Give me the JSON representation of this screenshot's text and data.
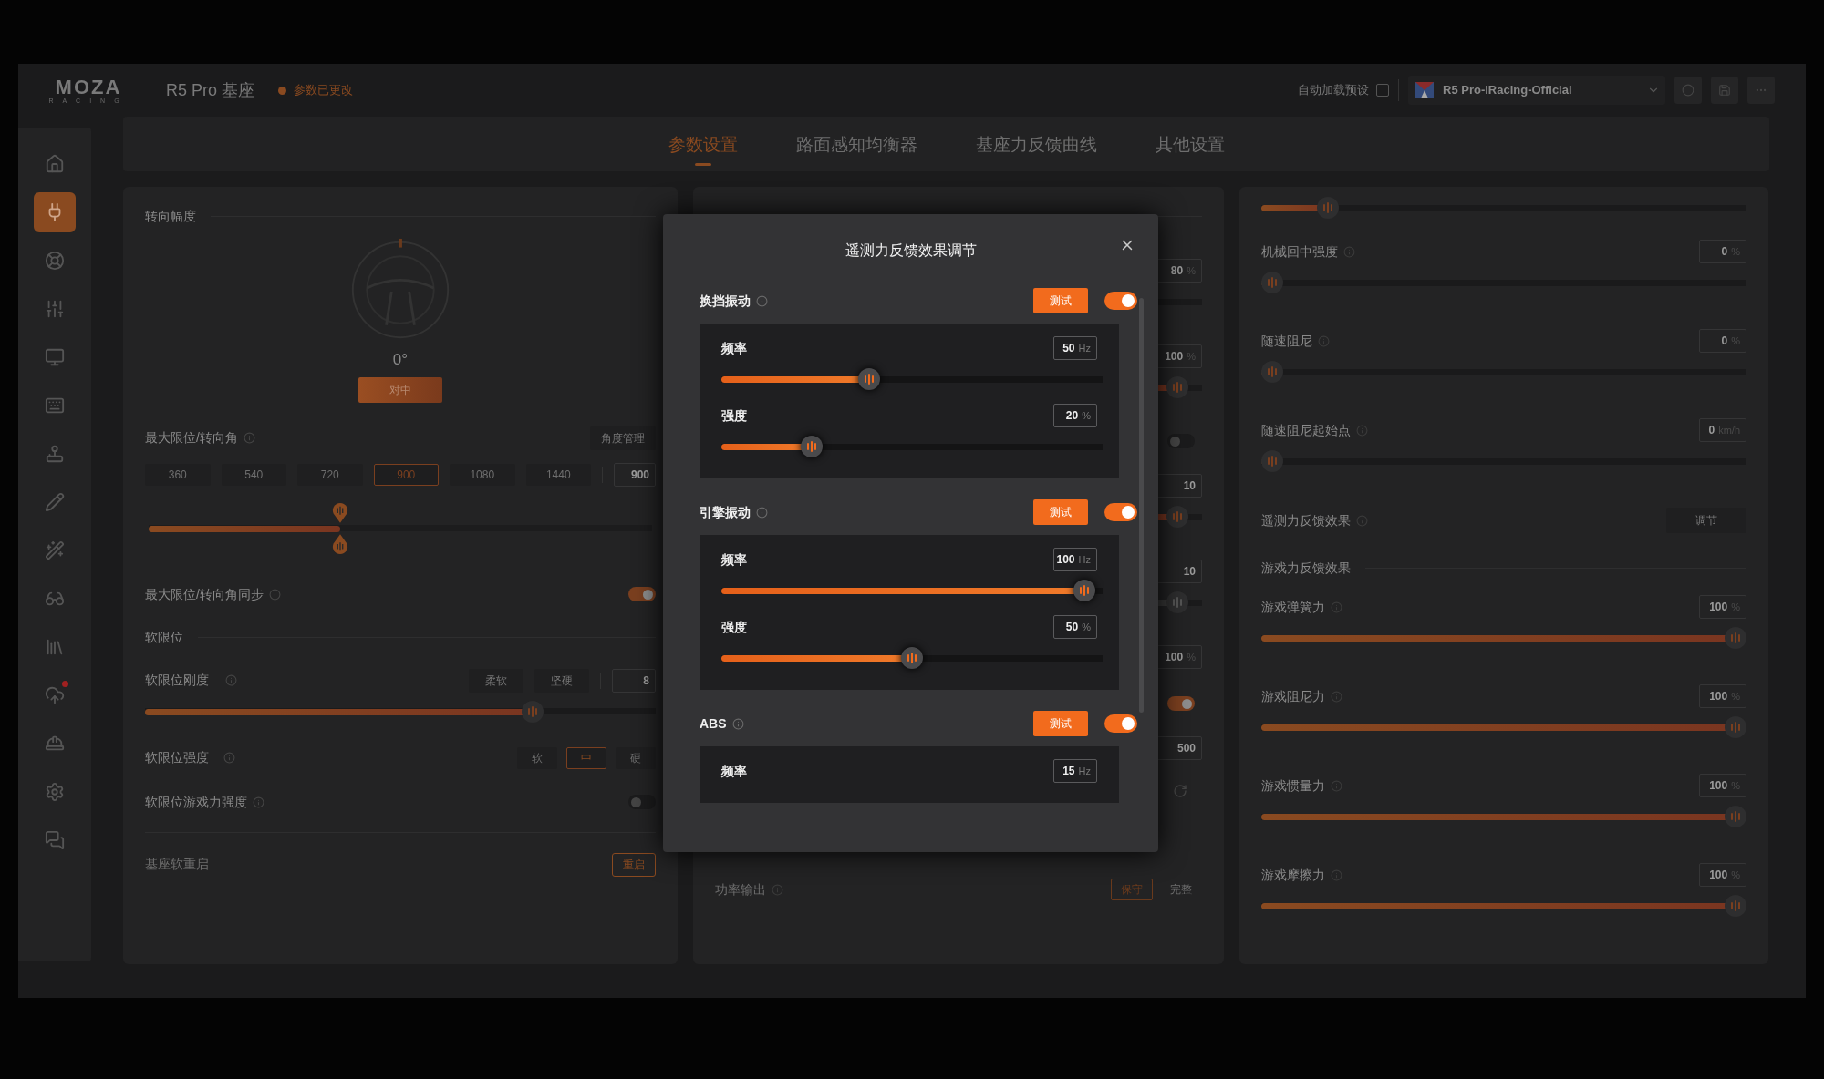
{
  "logo": {
    "brand": "MOZA",
    "tagline": "RACING"
  },
  "header": {
    "device": "R5 Pro 基座",
    "status": "参数已更改",
    "auto_load": {
      "label": "自动加载预设",
      "checked": false
    },
    "preset": "R5 Pro-iRacing-Official"
  },
  "sidebar": {
    "items": [
      {
        "selected": false,
        "notification": false
      },
      {
        "selected": true,
        "notification": false
      },
      {
        "selected": false,
        "notification": false
      },
      {
        "selected": false,
        "notification": false
      },
      {
        "selected": false,
        "notification": false
      },
      {
        "selected": false,
        "notification": false
      },
      {
        "selected": false,
        "notification": false
      },
      {
        "selected": false,
        "notification": false
      },
      {
        "selected": false,
        "notification": false
      },
      {
        "selected": false,
        "notification": false
      },
      {
        "selected": false,
        "notification": false
      },
      {
        "selected": false,
        "notification": true
      },
      {
        "selected": false,
        "notification": false
      },
      {
        "selected": false,
        "notification": false
      },
      {
        "selected": false,
        "notification": false
      }
    ]
  },
  "tabs": [
    {
      "label": "参数设置",
      "selected": true
    },
    {
      "label": "路面感知均衡器",
      "selected": false
    },
    {
      "label": "基座力反馈曲线",
      "selected": false
    },
    {
      "label": "其他设置",
      "selected": false
    }
  ],
  "left_panel": {
    "title": "转向幅度",
    "angle": "0°",
    "center_button": "对中",
    "max_angle": {
      "label": "最大限位/转向角",
      "manage_button": "角度管理",
      "presets": [
        {
          "label": "360",
          "selected": false
        },
        {
          "label": "540",
          "selected": false
        },
        {
          "label": "720",
          "selected": false
        },
        {
          "label": "900",
          "selected": true
        },
        {
          "label": "1080",
          "selected": false
        },
        {
          "label": "1440",
          "selected": false
        }
      ],
      "value": "900",
      "level": 0.38
    },
    "sync": {
      "label": "最大限位/转向角同步",
      "on": true
    },
    "soft_limit_title": "软限位",
    "stiffness": {
      "label": "软限位刚度",
      "options": [
        "柔软",
        "坚硬"
      ],
      "value": "8",
      "level": 0.77
    },
    "strength": {
      "label": "软限位强度",
      "options": [
        {
          "label": "软",
          "selected": false
        },
        {
          "label": "中",
          "selected": true
        },
        {
          "label": "硬",
          "selected": false
        }
      ]
    },
    "game_force": {
      "label": "软限位游戏力强度",
      "on": false
    },
    "restart": {
      "label": "基座软重启",
      "button": "重启"
    }
  },
  "middle_panel": {
    "rows": [
      {
        "kind": "slider",
        "value": "80",
        "unit": "%"
      },
      {
        "kind": "slider",
        "value": "100",
        "unit": "%",
        "level": 0.97,
        "disabled": false
      },
      {
        "kind": "toggle",
        "on": false
      },
      {
        "kind": "slider",
        "value": "10",
        "level": 0.97,
        "disabled": false
      },
      {
        "kind": "slider",
        "value": "10",
        "level": 0.97,
        "disabled": true
      },
      {
        "kind": "field",
        "value": "100",
        "unit": "%"
      },
      {
        "kind": "toggle",
        "on": true
      },
      {
        "kind": "field",
        "value": "500"
      },
      {
        "kind": "reset"
      }
    ],
    "power": {
      "label": "功率输出",
      "options": [
        {
          "label": "保守",
          "selected": true
        },
        {
          "label": "完整",
          "selected": false
        }
      ]
    }
  },
  "right_panel": {
    "top_slider": {
      "level": 0.12
    },
    "rows": [
      {
        "kind": "slider",
        "label": "机械回中强度",
        "value": "0",
        "unit": "%",
        "level": 0
      },
      {
        "kind": "slider",
        "label": "随速阻尼",
        "value": "0",
        "unit": "%",
        "level": 0
      },
      {
        "kind": "slider",
        "label": "随速阻尼起始点",
        "value": "0",
        "unit": "km/h",
        "level": 0
      },
      {
        "kind": "button",
        "label": "遥测力反馈效果",
        "button": "调节"
      },
      {
        "kind": "section",
        "label": "游戏力反馈效果"
      },
      {
        "kind": "slider",
        "label": "游戏弹簧力",
        "value": "100",
        "unit": "%",
        "level": 1
      },
      {
        "kind": "slider",
        "label": "游戏阻尼力",
        "value": "100",
        "unit": "%",
        "level": 1
      },
      {
        "kind": "slider",
        "label": "游戏惯量力",
        "value": "100",
        "unit": "%",
        "level": 1
      },
      {
        "kind": "slider",
        "label": "游戏摩擦力",
        "value": "100",
        "unit": "%",
        "level": 1
      }
    ]
  },
  "dialog": {
    "title": "遥测力反馈效果调节",
    "groups": [
      {
        "label": "换挡振动",
        "test": "测试",
        "on": true,
        "sliders": [
          {
            "label": "频率",
            "value": "50",
            "unit": "Hz",
            "level": 0.38
          },
          {
            "label": "强度",
            "value": "20",
            "unit": "%",
            "level": 0.22
          }
        ]
      },
      {
        "label": "引擎振动",
        "test": "测试",
        "on": true,
        "sliders": [
          {
            "label": "频率",
            "value": "100",
            "unit": "Hz",
            "level": 0.98
          },
          {
            "label": "强度",
            "value": "50",
            "unit": "%",
            "level": 0.5
          }
        ]
      },
      {
        "label": "ABS",
        "test": "测试",
        "on": true,
        "sliders": [
          {
            "label": "频率",
            "value": "15",
            "unit": "Hz"
          }
        ]
      }
    ]
  }
}
